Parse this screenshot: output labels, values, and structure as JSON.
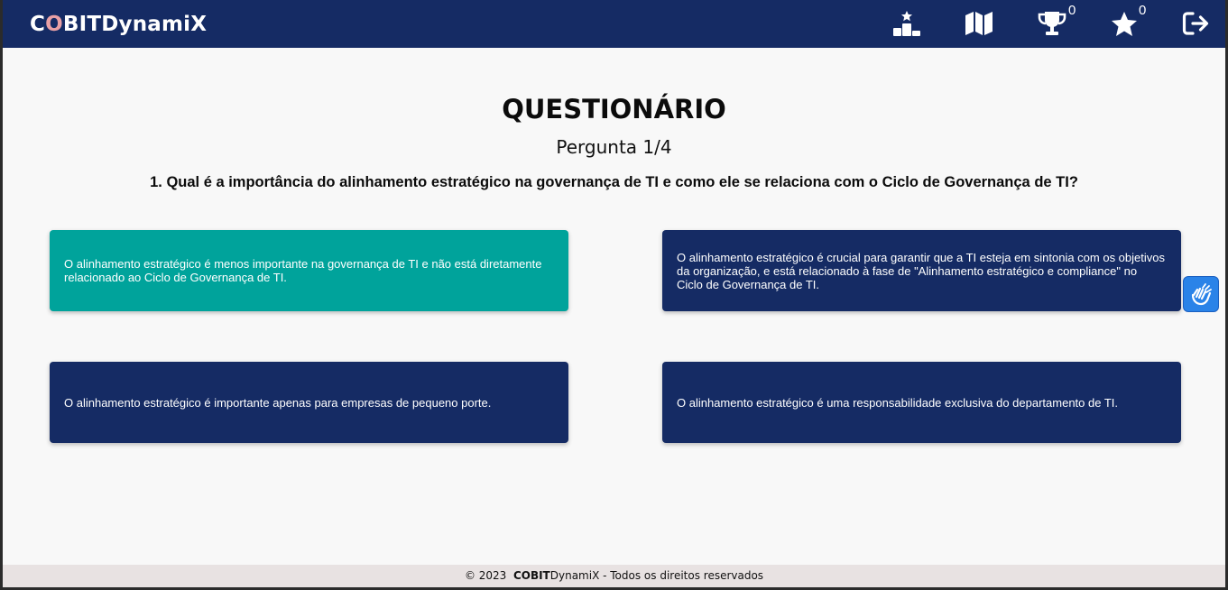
{
  "app": {
    "brand_first": "C",
    "brand_o": "O",
    "brand_rest": "BITDynamiX"
  },
  "nav": {
    "icons": [
      "leaderboard-icon",
      "map-icon",
      "trophy-icon",
      "star-icon",
      "logout-icon"
    ],
    "trophy_count": "0",
    "star_count": "0"
  },
  "quiz": {
    "title": "QUESTIONÁRIO",
    "counter": "Pergunta 1/4",
    "question": "1. Qual é a importância do alinhamento estratégico na governança de TI e como ele se relaciona com o Ciclo de Governança de TI?",
    "options": [
      "O alinhamento estratégico é menos importante na governança de TI e não está diretamente relacionado ao Ciclo de Governança de TI.",
      "O alinhamento estratégico é crucial para garantir que a TI esteja em sintonia com os objetivos da organização, e está relacionado à fase de \"Alinhamento estratégico e compliance\" no Ciclo de Governança de TI.",
      "O alinhamento estratégico é importante apenas para empresas de pequeno porte.",
      "O alinhamento estratégico é uma responsabilidade exclusiva do departamento de TI."
    ],
    "selected_option": 0
  },
  "accessibility": {
    "icon": "sign-language-icon"
  },
  "footer": {
    "copyright": "© 2023",
    "brand": "COBIT",
    "brand_rest": "DynamiX",
    "suffix": " - Todos os direitos reservados"
  },
  "colors": {
    "navbar": "#152b64",
    "option": "#152b64",
    "option_selected": "#00a39b",
    "accessibility_button": "#2a83e8",
    "brand_o": "#e8a0a5"
  }
}
